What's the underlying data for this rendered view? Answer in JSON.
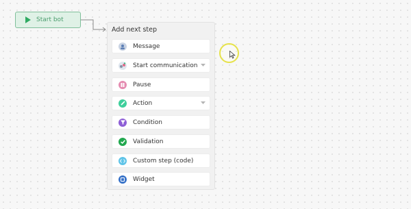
{
  "start_node": {
    "label": "Start bot",
    "color": "#4a9c6d"
  },
  "menu": {
    "title": "Add next step",
    "items": [
      {
        "label": "Message",
        "icon": "message-icon",
        "icon_color": "#a7b6cc",
        "has_dropdown": false
      },
      {
        "label": "Start communication",
        "icon": "start-communication-icon",
        "icon_color": "#9aa7b8",
        "has_dropdown": true
      },
      {
        "label": "Pause",
        "icon": "pause-icon",
        "icon_color": "#e58cb1",
        "has_dropdown": false
      },
      {
        "label": "Action",
        "icon": "action-icon",
        "icon_color": "#3fcf9c",
        "has_dropdown": true
      },
      {
        "label": "Condition",
        "icon": "condition-icon",
        "icon_color": "#8e5fd6",
        "has_dropdown": false
      },
      {
        "label": "Validation",
        "icon": "validation-icon",
        "icon_color": "#22a84f",
        "has_dropdown": false
      },
      {
        "label": "Custom step (code)",
        "icon": "custom-code-icon",
        "icon_color": "#5fc4e8",
        "has_dropdown": false
      },
      {
        "label": "Widget",
        "icon": "widget-icon",
        "icon_color": "#3a74c9",
        "has_dropdown": false
      }
    ]
  }
}
